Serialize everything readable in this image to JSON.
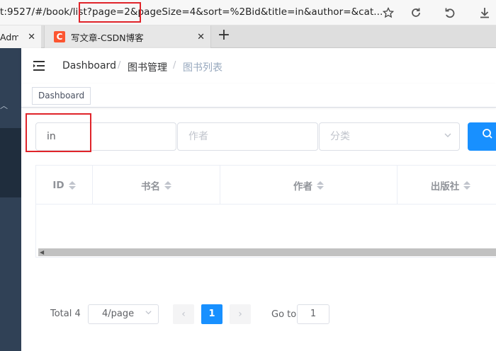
{
  "browser": {
    "url": "t:9527/#/book/list?page=2&pageSize=4&sort=%2Bid&title=in&author=&cat...",
    "tabs": [
      {
        "title": "Adm"
      },
      {
        "title": "写文章-CSDN博客"
      }
    ],
    "new_tab_label": "+"
  },
  "navbar": {
    "breadcrumbs": [
      "Dashboard",
      "图书管理",
      "图书列表"
    ],
    "separator": "/"
  },
  "tags_view": {
    "tags": [
      "Dashboard"
    ]
  },
  "filters": {
    "title_value": "in",
    "author_placeholder": "作者",
    "category_placeholder": "分类"
  },
  "table": {
    "columns": [
      "ID",
      "书名",
      "作者",
      "出版社"
    ],
    "rows": []
  },
  "pagination": {
    "total_label": "Total 4",
    "page_size_label": "4/page",
    "current_page": "1",
    "goto_label": "Go to",
    "goto_value": "1",
    "prev_icon": "‹",
    "next_icon": "›"
  },
  "colors": {
    "primary": "#1890ff",
    "sidebar": "#304156",
    "highlight": "#e0242a"
  }
}
